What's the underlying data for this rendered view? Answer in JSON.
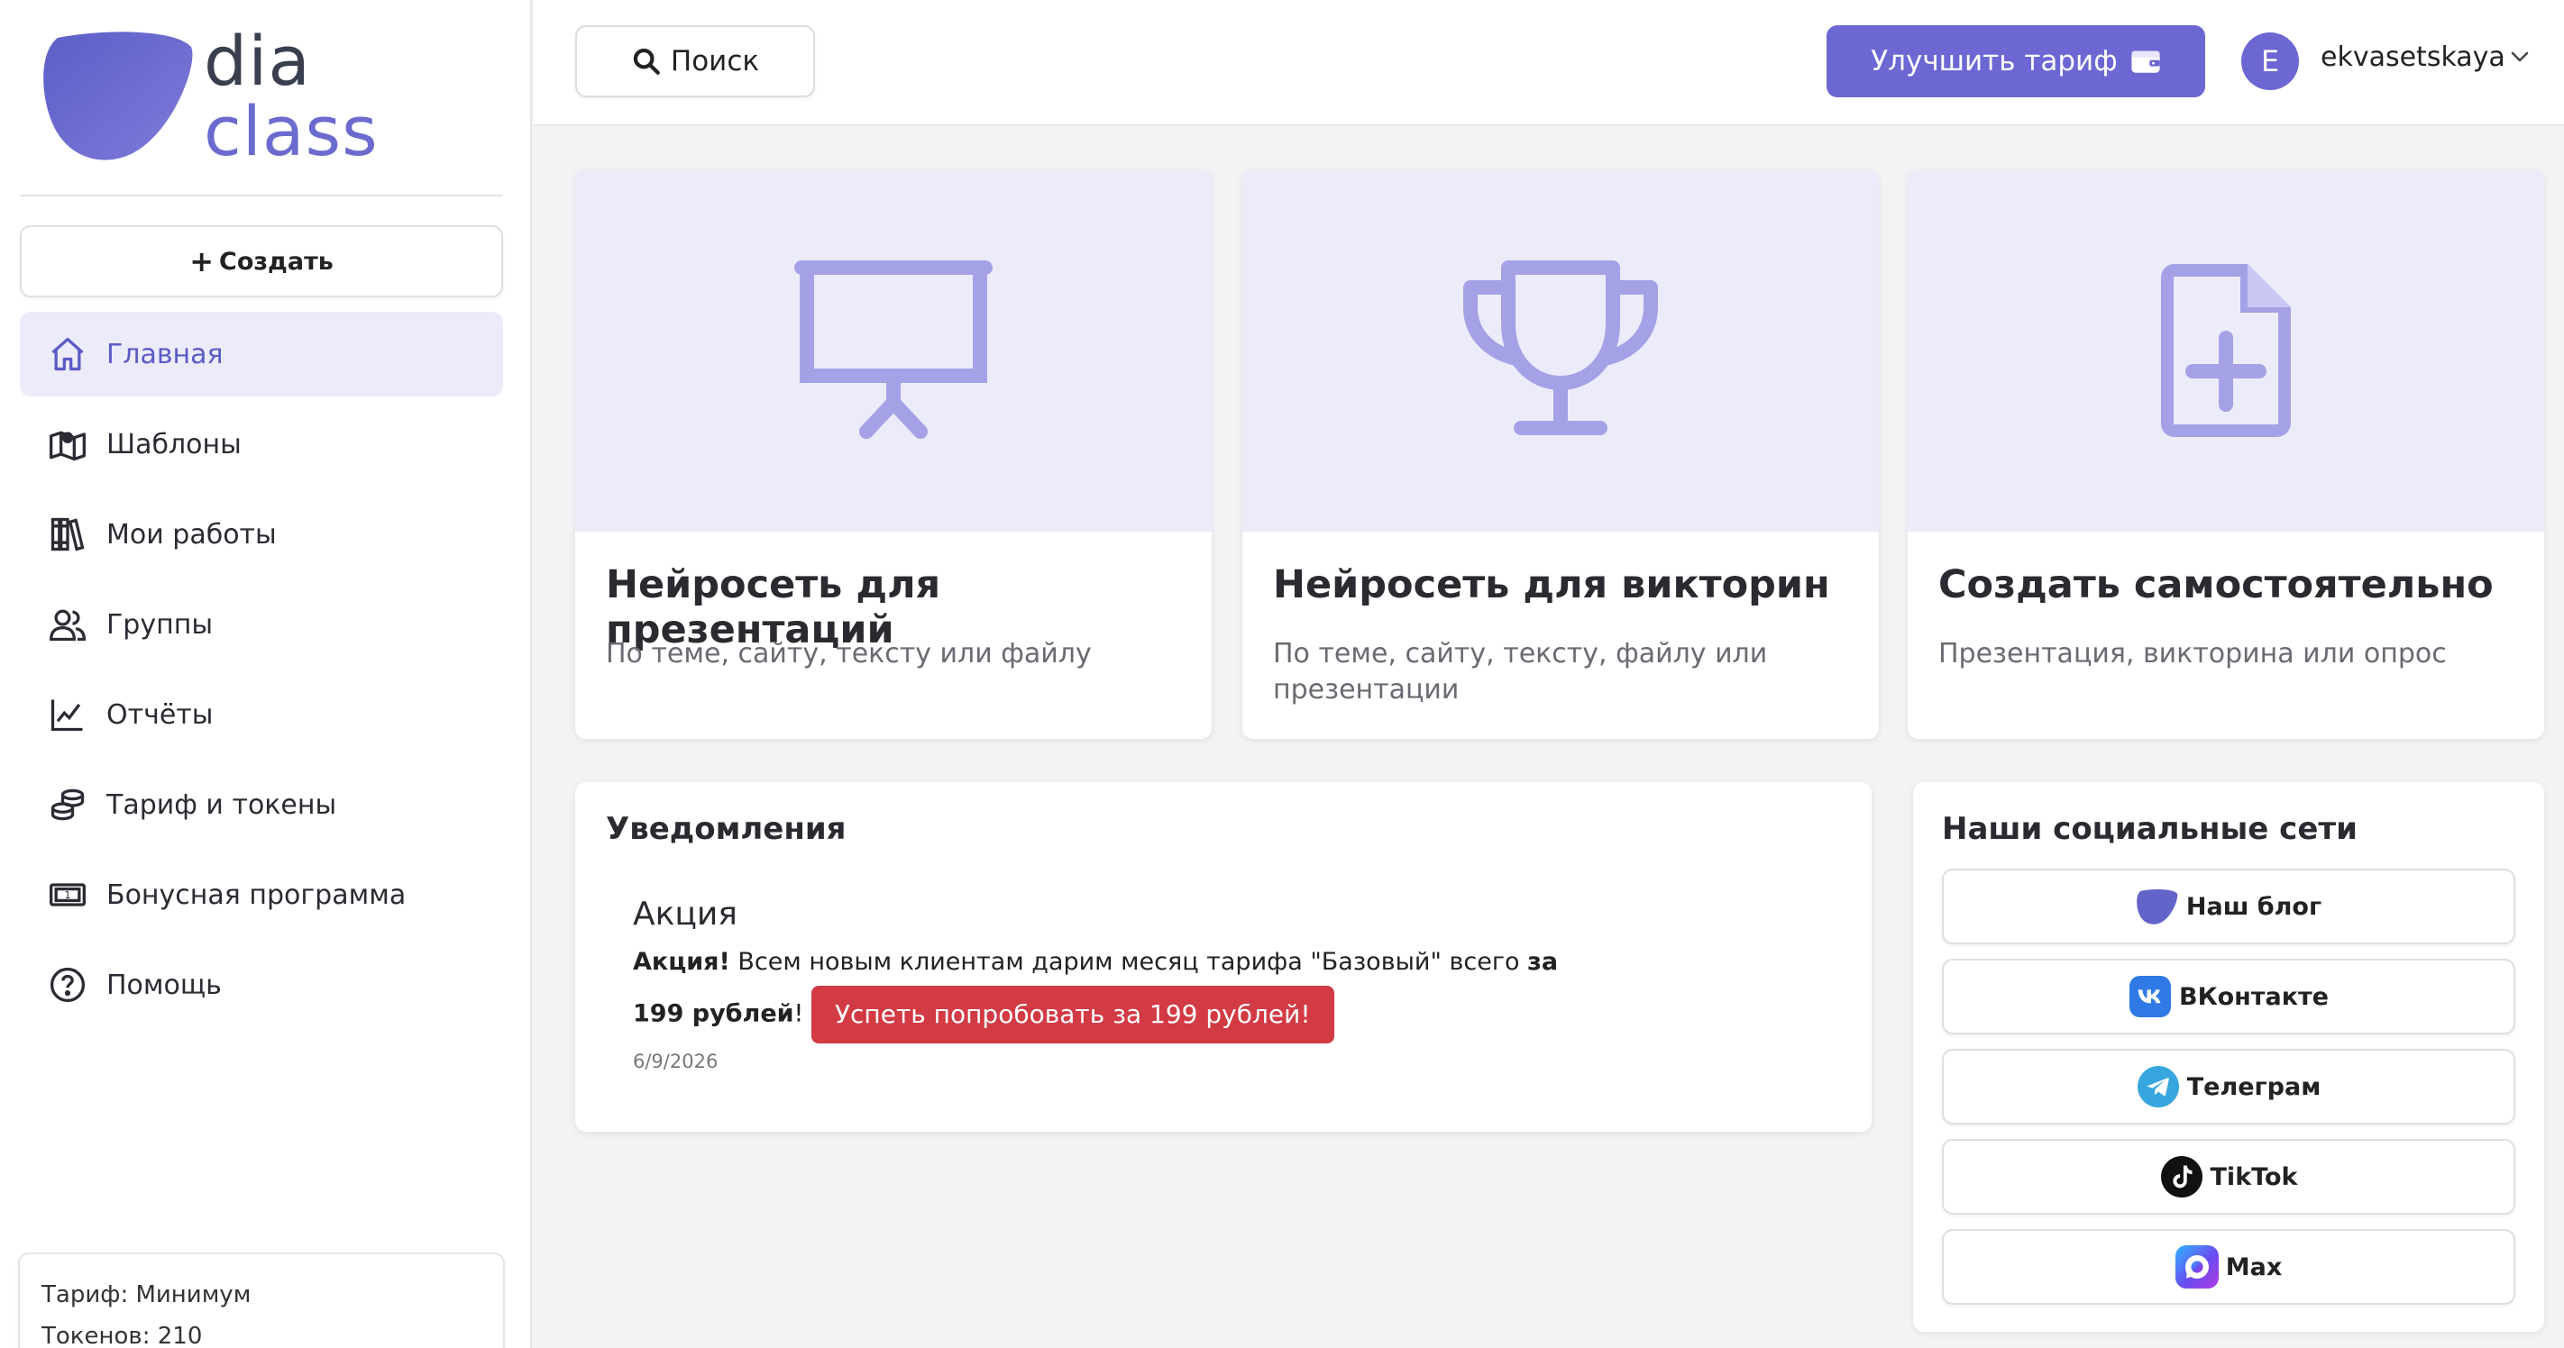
{
  "brand": {
    "line1": "dia",
    "line2": "class",
    "accent": "#6c67d3"
  },
  "sidebar": {
    "create_label": "Создать",
    "items": [
      {
        "label": "Главная",
        "icon": "home-icon",
        "active": true
      },
      {
        "label": "Шаблоны",
        "icon": "map-icon"
      },
      {
        "label": "Мои работы",
        "icon": "books-icon"
      },
      {
        "label": "Группы",
        "icon": "users-icon"
      },
      {
        "label": "Отчёты",
        "icon": "chart-icon"
      },
      {
        "label": "Тариф и токены",
        "icon": "coins-icon"
      },
      {
        "label": "Бонусная программа",
        "icon": "ticket-icon"
      },
      {
        "label": "Помощь",
        "icon": "help-icon"
      }
    ],
    "plan": {
      "plan_line": "Тариф: Минимум",
      "tokens_line": "Токенов: 210"
    }
  },
  "header": {
    "search_label": "Поиск",
    "upgrade_label": "Улучшить тариф",
    "avatar_letter": "E",
    "username": "ekvasetskaya"
  },
  "cards": [
    {
      "title": "Нейросеть для презентаций",
      "subtitle": "По теме, сайту, тексту или файлу",
      "icon": "presentation-icon"
    },
    {
      "title": "Нейросеть для викторин",
      "subtitle": "По теме, сайту, тексту, файлу или презентации",
      "icon": "trophy-icon"
    },
    {
      "title": "Создать самостоятельно",
      "subtitle": "Презентация, викторина или опрос",
      "icon": "file-plus-icon"
    }
  ],
  "notifications": {
    "title": "Уведомления",
    "promo": {
      "title": "Акция",
      "bold_lead": "Акция!",
      "text": " Всем новым клиентам дарим месяц тарифа \"Базовый\" всего ",
      "bold_price": "за 199 рублей",
      "after": "!",
      "button_label": "Успеть попробовать за 199 рублей!",
      "date": "6/9/2026"
    }
  },
  "social": {
    "title": "Наши социальные сети",
    "items": [
      {
        "label": "Наш блог",
        "icon": "diaclass-logo-icon"
      },
      {
        "label": "ВКонтакте",
        "icon": "vk-icon"
      },
      {
        "label": "Телеграм",
        "icon": "telegram-icon"
      },
      {
        "label": "TikTok",
        "icon": "tiktok-icon"
      },
      {
        "label": "Max",
        "icon": "max-icon"
      }
    ]
  }
}
